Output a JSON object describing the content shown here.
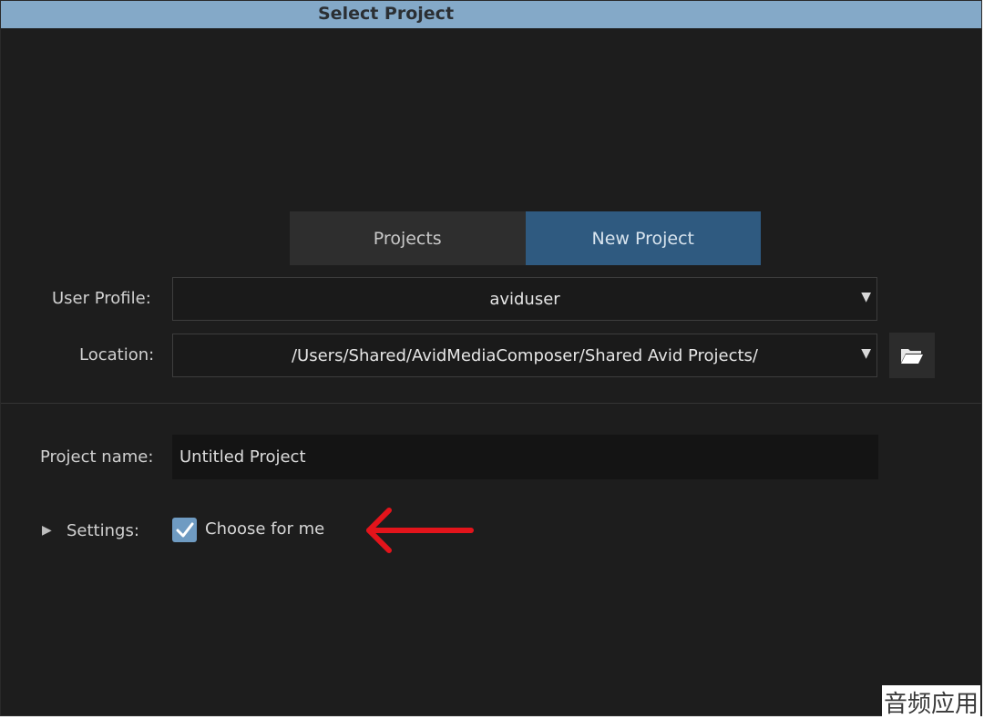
{
  "window": {
    "title": "Select Project"
  },
  "tabs": [
    {
      "label": "Projects",
      "active": false
    },
    {
      "label": "New Project",
      "active": true
    }
  ],
  "user_profile": {
    "label": "User Profile:",
    "value": "aviduser"
  },
  "location": {
    "label": "Location:",
    "value": "/Users/Shared/AvidMediaComposer/Shared Avid Projects/"
  },
  "project_name": {
    "label": "Project name:",
    "value": "Untitled Project"
  },
  "settings": {
    "label": "Settings:",
    "checkbox_label": "Choose for me",
    "checked": true
  },
  "watermark": "音频应用",
  "colors": {
    "titlebar": "#84a9c8",
    "active_tab": "#2f5a80",
    "background": "#1d1d1d",
    "annotation_arrow": "#e3141b"
  },
  "icons": [
    "dropdown-arrow-icon",
    "folder-icon",
    "disclosure-triangle-icon",
    "checkmark-icon",
    "red-arrow-annotation"
  ]
}
